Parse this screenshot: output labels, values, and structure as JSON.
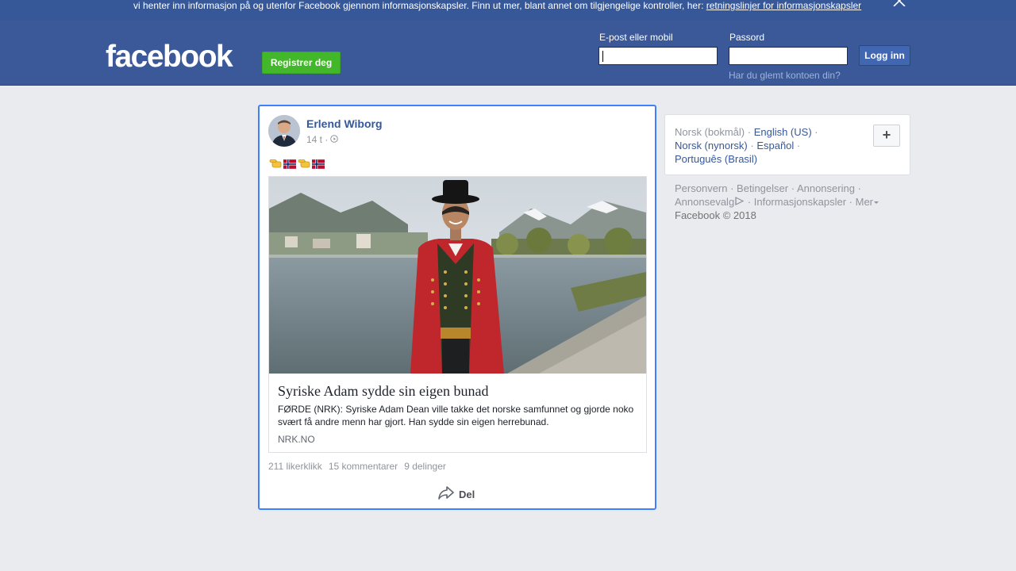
{
  "cookie_bar": {
    "text": "vi henter inn informasjon på og utenfor Facebook gjennom informasjonskapsler. Finn ut mer, blant annet om tilgjengelige kontroller, her: ",
    "link": "retningslinjer for informasjonskapsler"
  },
  "header": {
    "logo": "facebook",
    "register_label": "Registrer deg",
    "email_label": "E-post eller mobil",
    "password_label": "Passord",
    "login_label": "Logg inn",
    "forgot_label": "Har du glemt kontoen din?"
  },
  "post": {
    "author": "Erlend Wiborg",
    "time": "14 t ·",
    "emoji_icons": [
      "pointing-hand-icon",
      "norway-flag-icon",
      "pointing-hand-icon",
      "norway-flag-icon"
    ],
    "link": {
      "title": "Syriske Adam sydde sin eigen bunad",
      "description": "FØRDE (NRK): Syriske Adam Dean ville takke det norske samfunnet og gjorde noko svært få andre menn har gjort. Han sydde sin eigen herrebunad.",
      "domain": "NRK.NO"
    },
    "likes": "211 likerklikk",
    "comments": "15 kommentarer",
    "shares": "9 delinger",
    "share_label": "Del"
  },
  "languages": {
    "current": "Norsk (bokmål)",
    "items": [
      "English (US)",
      "Norsk (nynorsk)",
      "Español",
      "Português (Brasil)"
    ],
    "add_label": "+"
  },
  "footer": {
    "links": [
      "Personvern",
      "Betingelser",
      "Annonsering",
      "Annonsevalg",
      "Informasjonskapsler",
      "Mer"
    ],
    "copyright": "Facebook © 2018"
  },
  "colors": {
    "brand": "#3b5998",
    "register": "#42b72a",
    "link": "#365899",
    "focus_border": "#4080ff"
  }
}
